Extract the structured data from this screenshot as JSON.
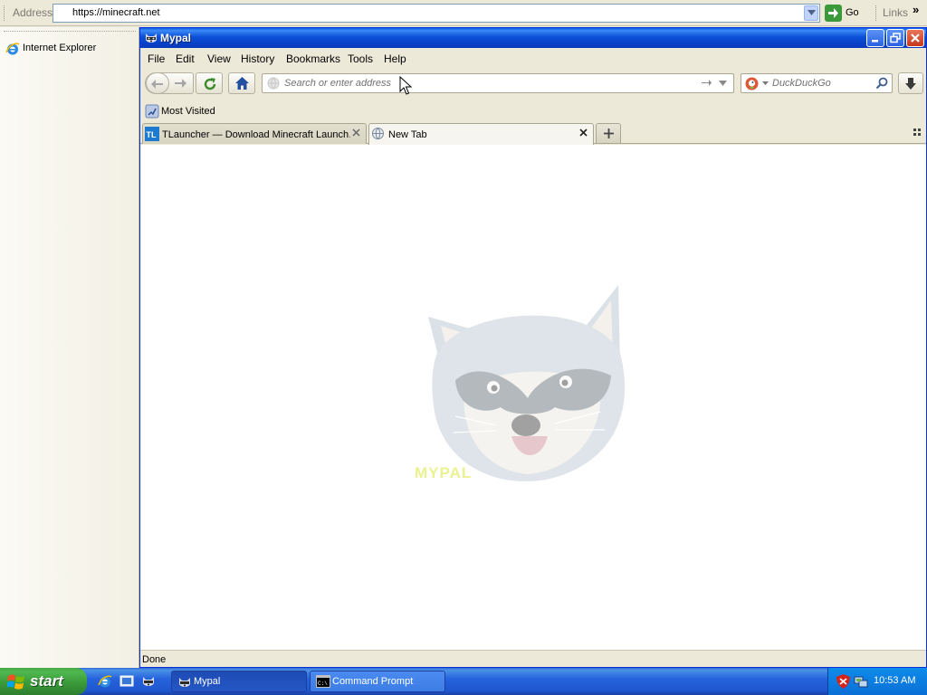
{
  "ie": {
    "address_label": "Address",
    "address_value": "https://minecraft.net",
    "go_label": "Go",
    "links_label": "Links",
    "chevron": "»",
    "sidebar_item": "Internet Explorer"
  },
  "window": {
    "title": "Mypal",
    "menu": [
      "File",
      "Edit",
      "View",
      "History",
      "Bookmarks",
      "Tools",
      "Help"
    ],
    "menu_underline": [
      "F",
      "E",
      "V",
      "H",
      "B",
      "T",
      "H"
    ],
    "url_placeholder": "Search or enter address",
    "search_placeholder": "DuckDuckGo",
    "bookmark_label": "Most Visited",
    "tabs": [
      {
        "label": "TLauncher — Download Minecraft Launch…",
        "active": false
      },
      {
        "label": "New Tab",
        "active": true
      }
    ],
    "watermark_text": "MYPAL",
    "status": "Done"
  },
  "taskbar": {
    "start_label": "start",
    "tasks": [
      {
        "label": "Mypal",
        "active": true
      },
      {
        "label": "Command Prompt",
        "active": false
      }
    ],
    "clock": "10:53 AM"
  },
  "colors": {
    "title_bar": "#0A4FD6",
    "taskbar": "#2663DD",
    "start_button": "#3A9A3A",
    "tray": "#0E8BEA",
    "close_button": "#C5381C"
  },
  "icons": [
    "ie-icon",
    "raccoon-icon",
    "minimize-icon",
    "maximize-icon",
    "close-icon",
    "back-icon",
    "forward-icon",
    "reload-icon",
    "home-icon",
    "globe-icon",
    "arrow-right-icon",
    "duckduckgo-icon",
    "search-icon",
    "download-icon",
    "bookmark-icon",
    "tlauncher-icon",
    "plus-icon",
    "tab-list-icon",
    "windows-flag-icon",
    "cmd-icon",
    "shield-icon",
    "network-icon",
    "cursor-icon"
  ]
}
